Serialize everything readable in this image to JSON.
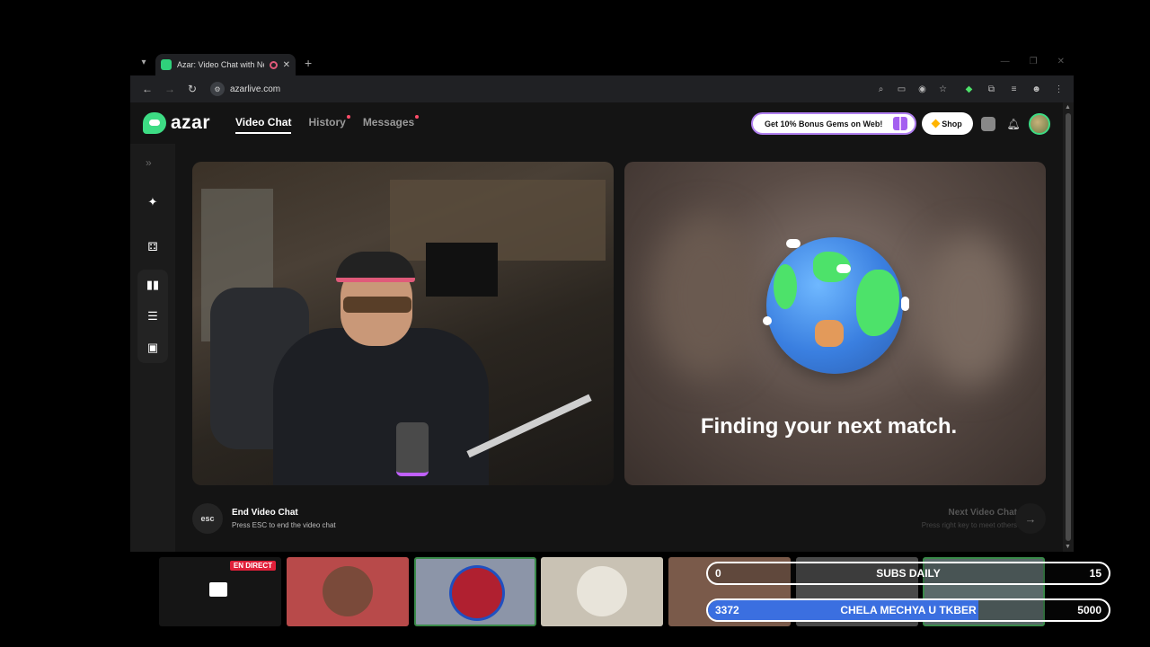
{
  "browser": {
    "tab_title": "Azar: Video Chat with New",
    "tab_close": "✕",
    "new_tab": "+",
    "url": "azarlive.com"
  },
  "app": {
    "logo_text": "azar",
    "nav": [
      {
        "label": "Video Chat"
      },
      {
        "label": "History"
      },
      {
        "label": "Messages"
      }
    ],
    "promo_label": "Get 10% Bonus Gems on Web!",
    "shop_label": "Shop"
  },
  "chat": {
    "status_text": "Finding your next match.",
    "esc_label": "esc",
    "end_title": "End Video Chat",
    "end_sub": "Press ESC to end the video chat",
    "next_title": "Next Video Chat",
    "next_sub": "Press right key to meet others"
  },
  "overlay": {
    "live_badge": "EN DIRECT",
    "subs": {
      "left": "0",
      "label": "SUBS DAILY",
      "right": "15"
    },
    "goal": {
      "left": "3372",
      "label": "CHELA MECHYA U TKBER",
      "right": "5000",
      "progress": 0.6744
    }
  },
  "colors": {
    "accent": "#3ddc84",
    "promo_border": "#b07ff0",
    "goal_fill": "#3b6fe0"
  }
}
